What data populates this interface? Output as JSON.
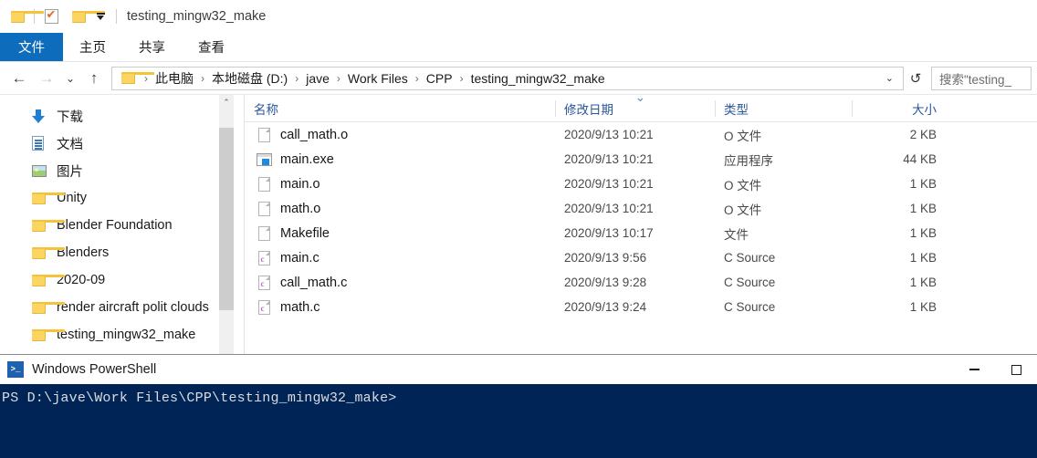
{
  "explorer": {
    "titlebar": {
      "title": "testing_mingw32_make",
      "icons": [
        "folder-icon",
        "properties-checkmark-icon",
        "new-folder-icon",
        "customize-quick-access-chevron-icon"
      ]
    },
    "ribbon_tabs": [
      {
        "label": "文件",
        "active": true
      },
      {
        "label": "主页",
        "active": false
      },
      {
        "label": "共享",
        "active": false
      },
      {
        "label": "查看",
        "active": false
      }
    ],
    "nav": {
      "back": "←",
      "forward": "→",
      "recent": "⌄",
      "up": "↑",
      "refresh": "↺",
      "dropdown": "⌄"
    },
    "breadcrumb": [
      "此电脑",
      "本地磁盘 (D:)",
      "jave",
      "Work Files",
      "CPP",
      "testing_mingw32_make"
    ],
    "breadcrumb_separator": "›",
    "search": {
      "placeholder": "搜索\"testing_"
    },
    "sidebar": {
      "items": [
        {
          "label": "下载",
          "icon": "download-icon",
          "pinned": true
        },
        {
          "label": "文档",
          "icon": "document-icon",
          "pinned": true
        },
        {
          "label": "图片",
          "icon": "pictures-icon",
          "pinned": true
        },
        {
          "label": "Unity",
          "icon": "folder-icon",
          "pinned": true
        },
        {
          "label": "Blender Foundation",
          "icon": "folder-icon",
          "pinned": true
        },
        {
          "label": "Blenders",
          "icon": "folder-icon",
          "pinned": true
        },
        {
          "label": "2020-09",
          "icon": "folder-icon",
          "pinned": false
        },
        {
          "label": "render aircraft polit clouds",
          "icon": "folder-icon",
          "pinned": false
        },
        {
          "label": "testing_mingw32_make",
          "icon": "folder-icon",
          "pinned": false
        }
      ],
      "pin_glyph": "✒",
      "scroll_up_glyph": "⌃"
    },
    "columns": [
      {
        "label": "名称",
        "key": "name",
        "sorted": false
      },
      {
        "label": "修改日期",
        "key": "date",
        "sorted": true
      },
      {
        "label": "类型",
        "key": "type",
        "sorted": false
      },
      {
        "label": "大小",
        "key": "size",
        "sorted": false
      }
    ],
    "files": [
      {
        "name": "call_math.o",
        "date": "2020/9/13 10:21",
        "type": "O 文件",
        "size": "2 KB",
        "icon": "blank-file-icon"
      },
      {
        "name": "main.exe",
        "date": "2020/9/13 10:21",
        "type": "应用程序",
        "size": "44 KB",
        "icon": "application-icon"
      },
      {
        "name": "main.o",
        "date": "2020/9/13 10:21",
        "type": "O 文件",
        "size": "1 KB",
        "icon": "blank-file-icon"
      },
      {
        "name": "math.o",
        "date": "2020/9/13 10:21",
        "type": "O 文件",
        "size": "1 KB",
        "icon": "blank-file-icon"
      },
      {
        "name": "Makefile",
        "date": "2020/9/13 10:17",
        "type": "文件",
        "size": "1 KB",
        "icon": "blank-file-icon"
      },
      {
        "name": "main.c",
        "date": "2020/9/13 9:56",
        "type": "C Source",
        "size": "1 KB",
        "icon": "c-source-icon"
      },
      {
        "name": "call_math.c",
        "date": "2020/9/13 9:28",
        "type": "C Source",
        "size": "1 KB",
        "icon": "c-source-icon"
      },
      {
        "name": "math.c",
        "date": "2020/9/13 9:24",
        "type": "C Source",
        "size": "1 KB",
        "icon": "c-source-icon"
      }
    ]
  },
  "powershell": {
    "title": "Windows PowerShell",
    "icon_glyph": ">_",
    "prompt": "PS D:\\jave\\Work Files\\CPP\\testing_mingw32_make>",
    "controls": {
      "minimize": "—",
      "maximize": "□"
    },
    "background_color": "#012456"
  }
}
